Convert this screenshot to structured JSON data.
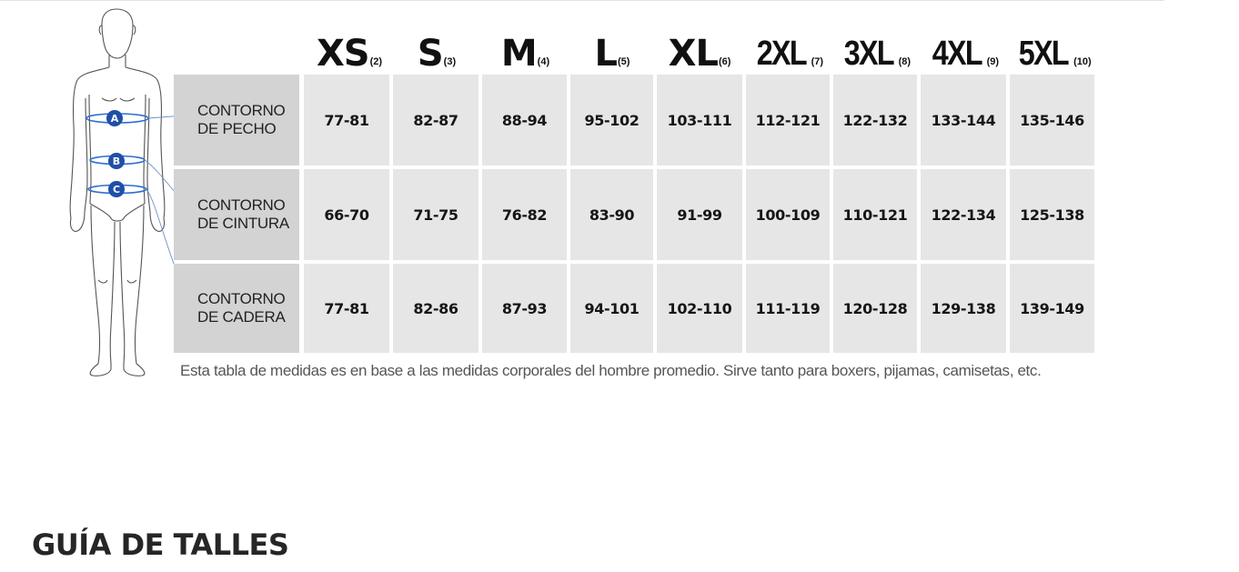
{
  "sizes": [
    {
      "code": "XS",
      "num": "(2)"
    },
    {
      "code": "S",
      "num": "(3)"
    },
    {
      "code": "M",
      "num": "(4)"
    },
    {
      "code": "L",
      "num": "(5)"
    },
    {
      "code": "XL",
      "num": "(6)"
    },
    {
      "code": "2XL",
      "num": "(7)"
    },
    {
      "code": "3XL",
      "num": "(8)"
    },
    {
      "code": "4XL",
      "num": "(9)"
    },
    {
      "code": "5XL",
      "num": "(10)"
    }
  ],
  "rows": [
    {
      "marker": "A",
      "label": [
        "CONTORNO",
        "DE PECHO"
      ],
      "values": [
        "77-81",
        "82-87",
        "88-94",
        "95-102",
        "103-111",
        "112-121",
        "122-132",
        "133-144",
        "135-146"
      ]
    },
    {
      "marker": "B",
      "label": [
        "CONTORNO",
        "DE CINTURA"
      ],
      "values": [
        "66-70",
        "71-75",
        "76-82",
        "83-90",
        "91-99",
        "100-109",
        "110-121",
        "122-134",
        "125-138"
      ]
    },
    {
      "marker": "C",
      "label": [
        "CONTORNO",
        "DE CADERA"
      ],
      "values": [
        "77-81",
        "82-86",
        "87-93",
        "94-101",
        "102-110",
        "111-119",
        "120-128",
        "129-138",
        "139-149"
      ]
    }
  ],
  "note": "Esta tabla de medidas es en base a las medidas corporales del hombre promedio. Sirve tanto para boxers, pijamas, camisetas, etc.",
  "guide_title": "GUÍA DE TALLES",
  "colors": {
    "marker": "#1f4fa8",
    "band": "#2f6fd0",
    "label_cell": "#d3d3d4",
    "value_cell": "#e6e6e7"
  }
}
